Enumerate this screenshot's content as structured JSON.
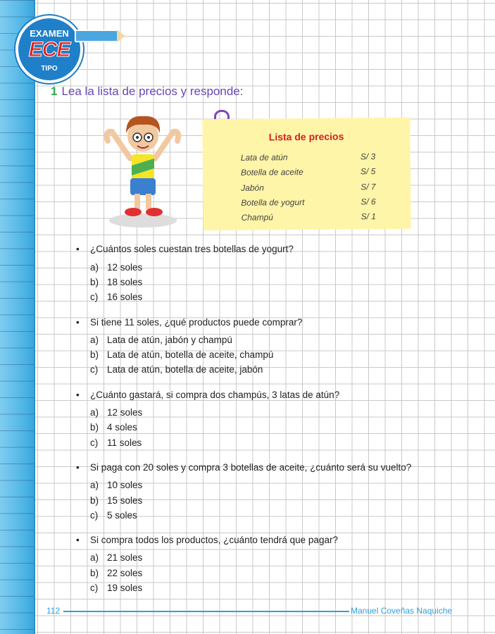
{
  "badge": {
    "top": "EXAMEN",
    "main": "ECE",
    "bottom": "TIPO"
  },
  "exercise": {
    "number": "1",
    "instruction": "Lea la lista de precios y responde:"
  },
  "price_list": {
    "title": "Lista de precios",
    "items": [
      {
        "name": "Lata de atún",
        "price": "S/ 3"
      },
      {
        "name": "Botella de aceite",
        "price": "S/ 5"
      },
      {
        "name": "Jabón",
        "price": "S/ 7"
      },
      {
        "name": "Botella de yogurt",
        "price": "S/ 6"
      },
      {
        "name": "Champú",
        "price": "S/ 1"
      }
    ]
  },
  "questions": [
    {
      "bullet": "•",
      "text": "¿Cuántos soles cuestan tres botellas de yogurt?",
      "options": [
        {
          "letter": "a)",
          "text": "12 soles"
        },
        {
          "letter": "b)",
          "text": "18 soles"
        },
        {
          "letter": "c)",
          "text": "16 soles"
        }
      ]
    },
    {
      "bullet": "•",
      "text": "Si tiene 11 soles, ¿qué productos puede comprar?",
      "options": [
        {
          "letter": "a)",
          "text": "Lata de atún, jabón y champú"
        },
        {
          "letter": "b)",
          "text": "Lata de atún, botella de aceite, champú"
        },
        {
          "letter": "c)",
          "text": "Lata de atún, botella de aceite, jabón"
        }
      ]
    },
    {
      "bullet": "•",
      "text": "¿Cuánto gastará, si compra dos champús, 3 latas de atún?",
      "options": [
        {
          "letter": "a)",
          "text": "12 soles"
        },
        {
          "letter": "b)",
          "text": "4 soles"
        },
        {
          "letter": "c)",
          "text": "11 soles"
        }
      ]
    },
    {
      "bullet": "•",
      "text": "Si paga con 20 soles y compra 3 botellas de aceite, ¿cuánto será su vuelto?",
      "options": [
        {
          "letter": "a)",
          "text": "10 soles"
        },
        {
          "letter": "b)",
          "text": "15 soles"
        },
        {
          "letter": "c)",
          "text": "5 soles"
        }
      ]
    },
    {
      "bullet": "•",
      "text": "Si compra todos los productos, ¿cuánto tendrá que pagar?",
      "options": [
        {
          "letter": "a)",
          "text": "21 soles"
        },
        {
          "letter": "b)",
          "text": "22 soles"
        },
        {
          "letter": "c)",
          "text": "19 soles"
        }
      ]
    }
  ],
  "footer": {
    "page": "112",
    "author": "Manuel Coveñas Naquiche"
  }
}
